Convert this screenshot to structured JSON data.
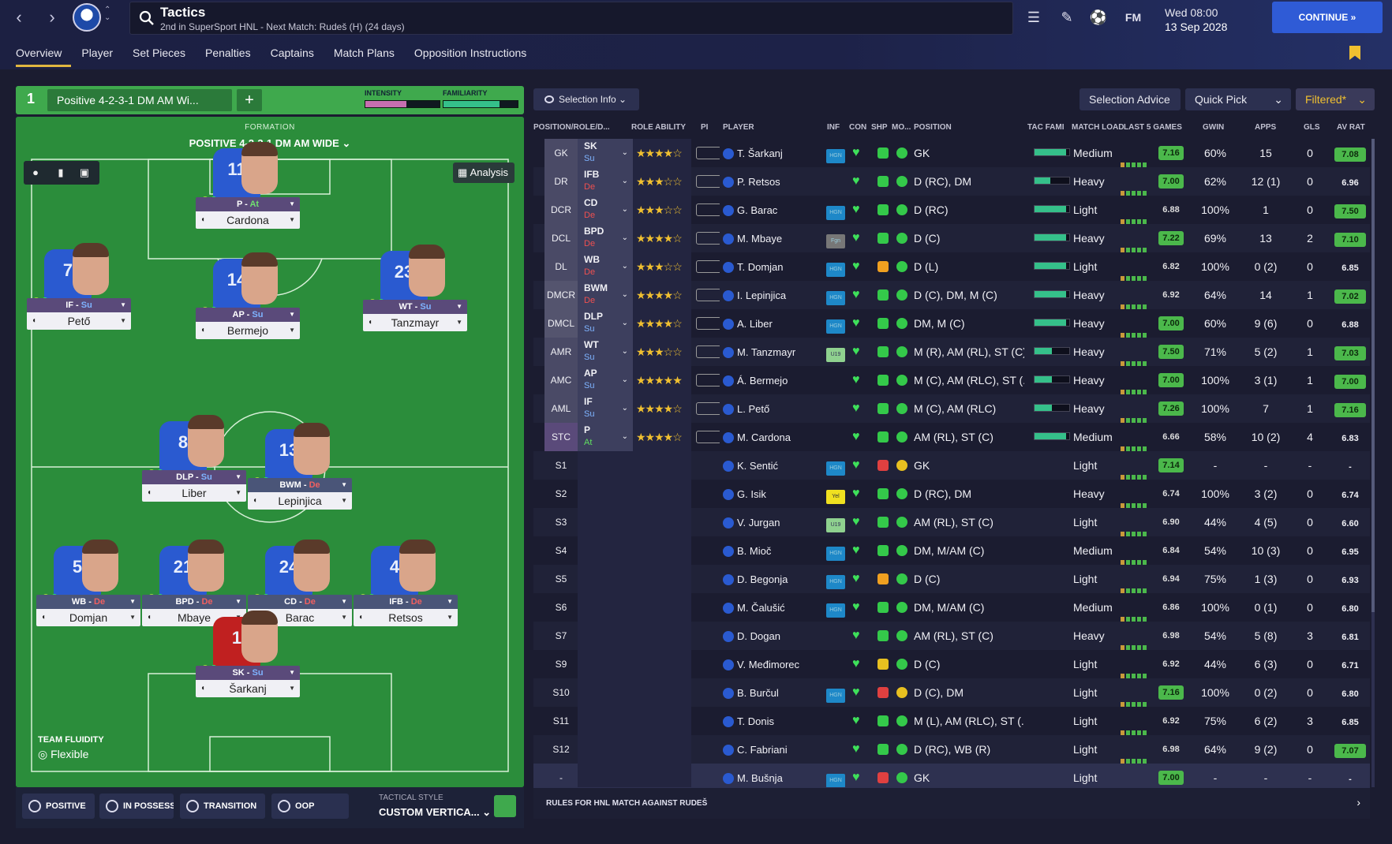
{
  "header": {
    "title": "Tactics",
    "subtitle": "2nd in SuperSport HNL - Next Match: Rudeš (H) (24 days)",
    "date_day": "Wed 08:00",
    "date_date": "13 Sep 2028",
    "continue_label": "CONTINUE",
    "fm_label": "FM",
    "icons": [
      "back-arrow-icon",
      "forward-arrow-icon",
      "club-crest-icon",
      "search-icon",
      "menu-icon",
      "pencil-icon",
      "ball-icon",
      "fm-icon"
    ]
  },
  "tabs": [
    "Overview",
    "Player",
    "Set Pieces",
    "Penalties",
    "Captains",
    "Match Plans",
    "Opposition Instructions"
  ],
  "tactic": {
    "slot": "1",
    "name": "Positive 4-2-3-1 DM AM Wi...",
    "add": "+",
    "intensity_label": "INTENSITY",
    "intensity_value": 0.55,
    "familiarity_label": "FAMILIARITY",
    "familiarity_value": 0.75,
    "formation_label": "FORMATION",
    "formation_name": "POSITIVE 4-2-3-1 DM AM WIDE",
    "analysis_label": "Analysis",
    "fluidity_label": "TEAM FLUIDITY",
    "fluidity_value": "Flexible"
  },
  "pitch_players": [
    {
      "num": "11",
      "role": "P",
      "duty": "At",
      "name": "Cardona",
      "key": "cardona"
    },
    {
      "num": "7",
      "role": "IF",
      "duty": "Su",
      "name": "Pető",
      "key": "peto"
    },
    {
      "num": "14",
      "role": "AP",
      "duty": "Su",
      "name": "Bermejo",
      "key": "bermejo"
    },
    {
      "num": "23",
      "role": "WT",
      "duty": "Su",
      "name": "Tanzmayr",
      "key": "tanzmayr"
    },
    {
      "num": "8",
      "role": "DLP",
      "duty": "Su",
      "name": "Liber",
      "key": "liber"
    },
    {
      "num": "13",
      "role": "BWM",
      "duty": "De",
      "name": "Lepinjica",
      "key": "lepinjica"
    },
    {
      "num": "5",
      "role": "WB",
      "duty": "De",
      "name": "Domjan",
      "key": "domjan"
    },
    {
      "num": "21",
      "role": "BPD",
      "duty": "De",
      "name": "Mbaye",
      "key": "mbaye"
    },
    {
      "num": "24",
      "role": "CD",
      "duty": "De",
      "name": "Barac",
      "key": "barac"
    },
    {
      "num": "4",
      "role": "IFB",
      "duty": "De",
      "name": "Retsos",
      "key": "retsos"
    },
    {
      "num": "1",
      "role": "SK",
      "duty": "Su",
      "name": "Šarkanj",
      "key": "sarkanj"
    }
  ],
  "footer_left": {
    "positive": "POSITIVE",
    "in_possession": "IN POSSESSI...",
    "transition": "TRANSITION",
    "oop": "OOP",
    "style_label": "TACTICAL STYLE",
    "style_value": "CUSTOM VERTICA..."
  },
  "toolbar": {
    "selection_info": "Selection Info",
    "selection_advice": "Selection Advice",
    "quick_pick": "Quick Pick",
    "filtered": "Filtered*"
  },
  "columns": {
    "pos_role": "POSITION/ROLE/D...",
    "role_ability": "ROLE ABILITY",
    "pi": "PI",
    "player": "PLAYER",
    "inf": "INF",
    "con": "CON",
    "shp": "SHP",
    "mo": "MO...",
    "position": "POSITION",
    "tac_fami": "TAC FAMI",
    "match_load": "MATCH LOAD",
    "last5": "LAST 5 GAMES",
    "gwin": "GWIN",
    "apps": "APPS",
    "gls": "GLS",
    "avrat": "AV RAT"
  },
  "rows": [
    {
      "pos": "GK",
      "role": "SK",
      "duty": "Su",
      "stars": "★★★★☆",
      "player": "T. Šarkanj",
      "inf": "HGN",
      "position": "GK",
      "tac": 0.9,
      "load": "Medium",
      "last": "7.16",
      "last_hi": true,
      "gwin": "60%",
      "apps": "15",
      "gls": "0",
      "avr": "7.08",
      "avr_hi": true,
      "shp": "green",
      "mo": "green"
    },
    {
      "pos": "DR",
      "role": "IFB",
      "duty": "De",
      "stars": "★★★☆☆",
      "player": "P. Retsos",
      "inf": "",
      "position": "D (RC), DM",
      "tac": 0.45,
      "load": "Heavy",
      "last": "7.00",
      "last_hi": true,
      "gwin": "62%",
      "apps": "12 (1)",
      "gls": "0",
      "avr": "6.96",
      "avr_hi": false,
      "shp": "green",
      "mo": "green"
    },
    {
      "pos": "DCR",
      "role": "CD",
      "duty": "De",
      "stars": "★★★☆☆",
      "player": "G. Barac",
      "inf": "HGN",
      "position": "D (RC)",
      "tac": 0.9,
      "load": "Light",
      "last": "6.88",
      "last_hi": false,
      "gwin": "100%",
      "apps": "1",
      "gls": "0",
      "avr": "7.50",
      "avr_hi": true,
      "shp": "green",
      "mo": "green"
    },
    {
      "pos": "DCL",
      "role": "BPD",
      "duty": "De",
      "stars": "★★★★☆",
      "player": "M. Mbaye",
      "inf": "Fgn",
      "position": "D (C)",
      "tac": 0.9,
      "load": "Heavy",
      "last": "7.22",
      "last_hi": true,
      "gwin": "69%",
      "apps": "13",
      "gls": "2",
      "avr": "7.10",
      "avr_hi": true,
      "shp": "green",
      "mo": "green"
    },
    {
      "pos": "DL",
      "role": "WB",
      "duty": "De",
      "stars": "★★★☆☆",
      "player": "T. Domjan",
      "inf": "HGN",
      "position": "D (L)",
      "tac": 0.9,
      "load": "Light",
      "last": "6.82",
      "last_hi": false,
      "gwin": "100%",
      "apps": "0 (2)",
      "gls": "0",
      "avr": "6.85",
      "avr_hi": false,
      "shp": "orange",
      "mo": "green"
    },
    {
      "pos": "DMCR",
      "role": "BWM",
      "duty": "De",
      "stars": "★★★★☆",
      "player": "I. Lepinjica",
      "inf": "HGN",
      "position": "D (C), DM, M (C)",
      "tac": 0.9,
      "load": "Heavy",
      "last": "6.92",
      "last_hi": false,
      "gwin": "64%",
      "apps": "14",
      "gls": "1",
      "avr": "7.02",
      "avr_hi": true,
      "shp": "green",
      "mo": "green"
    },
    {
      "pos": "DMCL",
      "role": "DLP",
      "duty": "Su",
      "stars": "★★★★☆",
      "player": "A. Liber",
      "inf": "HGN",
      "position": "DM, M (C)",
      "tac": 0.9,
      "load": "Heavy",
      "last": "7.00",
      "last_hi": true,
      "gwin": "60%",
      "apps": "9 (6)",
      "gls": "0",
      "avr": "6.88",
      "avr_hi": false,
      "shp": "green",
      "mo": "green"
    },
    {
      "pos": "AMR",
      "role": "WT",
      "duty": "Su",
      "stars": "★★★☆☆",
      "player": "M. Tanzmayr",
      "inf": "U19",
      "position": "M (R), AM (RL), ST (C)",
      "tac": 0.5,
      "load": "Heavy",
      "last": "7.50",
      "last_hi": true,
      "gwin": "71%",
      "apps": "5 (2)",
      "gls": "1",
      "avr": "7.03",
      "avr_hi": true,
      "shp": "green",
      "mo": "green"
    },
    {
      "pos": "AMC",
      "role": "AP",
      "duty": "Su",
      "stars": "★★★★★",
      "player": "Á. Bermejo",
      "inf": "",
      "position": "M (C), AM (RLC), ST (...",
      "tac": 0.5,
      "load": "Heavy",
      "last": "7.00",
      "last_hi": true,
      "gwin": "100%",
      "apps": "3 (1)",
      "gls": "1",
      "avr": "7.00",
      "avr_hi": true,
      "shp": "green",
      "mo": "green"
    },
    {
      "pos": "AML",
      "role": "IF",
      "duty": "Su",
      "stars": "★★★★☆",
      "player": "L. Pető",
      "inf": "",
      "position": "M (C), AM (RLC)",
      "tac": 0.5,
      "load": "Heavy",
      "last": "7.26",
      "last_hi": true,
      "gwin": "100%",
      "apps": "7",
      "gls": "1",
      "avr": "7.16",
      "avr_hi": true,
      "shp": "green",
      "mo": "green"
    },
    {
      "pos": "STC",
      "role": "P",
      "duty": "At",
      "stars": "★★★★☆",
      "player": "M. Cardona",
      "inf": "",
      "position": "AM (RL), ST (C)",
      "tac": 0.9,
      "load": "Medium",
      "last": "6.66",
      "last_hi": false,
      "gwin": "58%",
      "apps": "10 (2)",
      "gls": "4",
      "avr": "6.83",
      "avr_hi": false,
      "shp": "green",
      "mo": "green"
    },
    {
      "pos": "S1",
      "role": "",
      "duty": "",
      "stars": "",
      "player": "K. Sentić",
      "inf": "HGN",
      "position": "GK",
      "tac": 0,
      "load": "Light",
      "last": "7.14",
      "last_hi": true,
      "gwin": "-",
      "apps": "-",
      "gls": "-",
      "avr": "-",
      "avr_hi": false,
      "shp": "red",
      "mo": "yellow"
    },
    {
      "pos": "S2",
      "role": "",
      "duty": "",
      "stars": "",
      "player": "G. Isik",
      "inf": "Yel",
      "position": "D (RC), DM",
      "tac": 0,
      "load": "Heavy",
      "last": "6.74",
      "last_hi": false,
      "gwin": "100%",
      "apps": "3 (2)",
      "gls": "0",
      "avr": "6.74",
      "avr_hi": false,
      "shp": "green",
      "mo": "green"
    },
    {
      "pos": "S3",
      "role": "",
      "duty": "",
      "stars": "",
      "player": "V. Jurgan",
      "inf": "U19",
      "position": "AM (RL), ST (C)",
      "tac": 0,
      "load": "Light",
      "last": "6.90",
      "last_hi": false,
      "gwin": "44%",
      "apps": "4 (5)",
      "gls": "0",
      "avr": "6.60",
      "avr_hi": false,
      "shp": "green",
      "mo": "green"
    },
    {
      "pos": "S4",
      "role": "",
      "duty": "",
      "stars": "",
      "player": "B. Mioč",
      "inf": "HGN",
      "position": "DM, M/AM (C)",
      "tac": 0,
      "load": "Medium",
      "last": "6.84",
      "last_hi": false,
      "gwin": "54%",
      "apps": "10 (3)",
      "gls": "0",
      "avr": "6.95",
      "avr_hi": false,
      "shp": "green",
      "mo": "green"
    },
    {
      "pos": "S5",
      "role": "",
      "duty": "",
      "stars": "",
      "player": "D. Begonja",
      "inf": "HGN",
      "position": "D (C)",
      "tac": 0,
      "load": "Light",
      "last": "6.94",
      "last_hi": false,
      "gwin": "75%",
      "apps": "1 (3)",
      "gls": "0",
      "avr": "6.93",
      "avr_hi": false,
      "shp": "orange",
      "mo": "green"
    },
    {
      "pos": "S6",
      "role": "",
      "duty": "",
      "stars": "",
      "player": "M. Čalušić",
      "inf": "HGN",
      "position": "DM, M/AM (C)",
      "tac": 0,
      "load": "Medium",
      "last": "6.86",
      "last_hi": false,
      "gwin": "100%",
      "apps": "0 (1)",
      "gls": "0",
      "avr": "6.80",
      "avr_hi": false,
      "shp": "green",
      "mo": "green"
    },
    {
      "pos": "S7",
      "role": "",
      "duty": "",
      "stars": "",
      "player": "D. Dogan",
      "inf": "",
      "position": "AM (RL), ST (C)",
      "tac": 0,
      "load": "Heavy",
      "last": "6.98",
      "last_hi": false,
      "gwin": "54%",
      "apps": "5 (8)",
      "gls": "3",
      "avr": "6.81",
      "avr_hi": false,
      "shp": "green",
      "mo": "green"
    },
    {
      "pos": "S9",
      "role": "",
      "duty": "",
      "stars": "",
      "player": "V. Međimorec",
      "inf": "",
      "position": "D (C)",
      "tac": 0,
      "load": "Light",
      "last": "6.92",
      "last_hi": false,
      "gwin": "44%",
      "apps": "6 (3)",
      "gls": "0",
      "avr": "6.71",
      "avr_hi": false,
      "shp": "yellow",
      "mo": "green"
    },
    {
      "pos": "S10",
      "role": "",
      "duty": "",
      "stars": "",
      "player": "B. Burčul",
      "inf": "HGN",
      "position": "D (C), DM",
      "tac": 0,
      "load": "Light",
      "last": "7.16",
      "last_hi": true,
      "gwin": "100%",
      "apps": "0 (2)",
      "gls": "0",
      "avr": "6.80",
      "avr_hi": false,
      "shp": "red",
      "mo": "yellow"
    },
    {
      "pos": "S11",
      "role": "",
      "duty": "",
      "stars": "",
      "player": "T. Donis",
      "inf": "",
      "position": "M (L), AM (RLC), ST (...",
      "tac": 0,
      "load": "Light",
      "last": "6.92",
      "last_hi": false,
      "gwin": "75%",
      "apps": "6 (2)",
      "gls": "3",
      "avr": "6.85",
      "avr_hi": false,
      "shp": "green",
      "mo": "green"
    },
    {
      "pos": "S12",
      "role": "",
      "duty": "",
      "stars": "",
      "player": "C. Fabriani",
      "inf": "",
      "position": "D (RC), WB (R)",
      "tac": 0,
      "load": "Light",
      "last": "6.98",
      "last_hi": false,
      "gwin": "64%",
      "apps": "9 (2)",
      "gls": "0",
      "avr": "7.07",
      "avr_hi": true,
      "shp": "green",
      "mo": "green"
    },
    {
      "pos": "-",
      "role": "",
      "duty": "",
      "stars": "",
      "player": "M. Bušnja",
      "inf": "HGN",
      "position": "GK",
      "tac": 0,
      "load": "Light",
      "last": "7.00",
      "last_hi": true,
      "gwin": "-",
      "apps": "-",
      "gls": "-",
      "avr": "-",
      "avr_hi": false,
      "shp": "red",
      "mo": "green"
    }
  ],
  "footer_right": {
    "rules": "RULES FOR HNL MATCH AGAINST RUDEŠ"
  },
  "colors": {
    "accent": "#2f5bd6",
    "pitch": "#2a8a3a",
    "green": "#4bb84b",
    "gold": "#f0c030"
  }
}
